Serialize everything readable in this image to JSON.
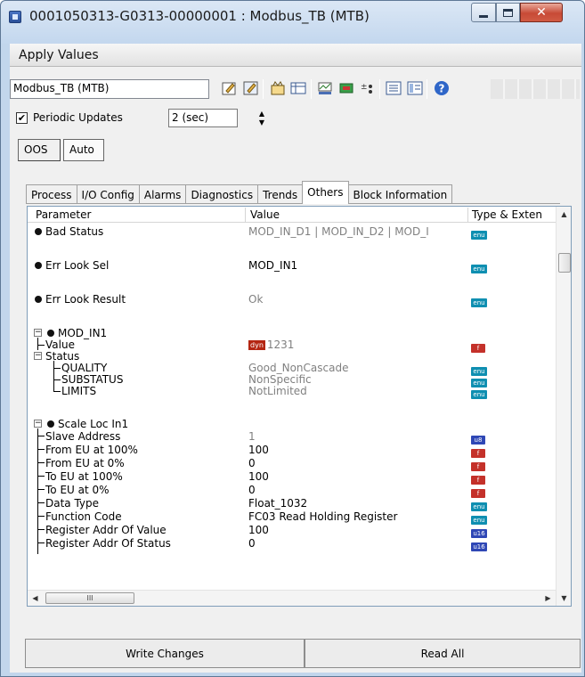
{
  "window": {
    "title": "0001050313-G0313-00000001 : Modbus_TB (MTB)",
    "icon": "app-icon"
  },
  "menu": {
    "label": "Apply Values"
  },
  "toolbar": {
    "block_select": "Modbus_TB (MTB)",
    "icons": [
      "edit-icon",
      "edit-all-icon",
      "block-info-icon",
      "spreadsheet-icon",
      "chart-icon",
      "transfer-icon",
      "tree-toggle-icon",
      "list-view-icon",
      "detail-view-icon",
      "help-icon"
    ]
  },
  "periodic": {
    "label": "Periodic Updates",
    "checked": true,
    "interval": "2 (sec)"
  },
  "modes": {
    "oos": "OOS",
    "auto": "Auto"
  },
  "tabs": [
    "Process",
    "I/O Config",
    "Alarms",
    "Diagnostics",
    "Trends",
    "Others",
    "Block Information"
  ],
  "active_tab": "Others",
  "grid": {
    "headers": {
      "parameter": "Parameter",
      "value": "Value",
      "type": "Type & Exten"
    },
    "rows": [
      {
        "name": "Bad Status",
        "value": "MOD_IN_D1 | MOD_IN_D2 | MOD_I",
        "type": "enu",
        "gray": true
      },
      {
        "name": "Err Look Sel",
        "value": "MOD_IN1",
        "type": "enu",
        "gray": false
      },
      {
        "name": "Err Look Result",
        "value": "Ok",
        "type": "enu",
        "gray": true
      },
      {
        "name": "MOD_IN1"
      },
      {
        "name": "Value",
        "value": "1231",
        "dyn": "dyn",
        "type": "f"
      },
      {
        "name": "Status"
      },
      {
        "name": "QUALITY",
        "value": "Good_NonCascade",
        "type": "enu"
      },
      {
        "name": "SUBSTATUS",
        "value": "NonSpecific",
        "type": "enu"
      },
      {
        "name": "LIMITS",
        "value": "NotLimited",
        "type": "enu"
      },
      {
        "name": "Scale Loc In1"
      },
      {
        "name": "Slave Address",
        "value": "1",
        "type": "u8"
      },
      {
        "name": "From EU at 100%",
        "value": "100",
        "type": "f"
      },
      {
        "name": "From EU at 0%",
        "value": "0",
        "type": "f"
      },
      {
        "name": "To EU at 100%",
        "value": "100",
        "type": "f"
      },
      {
        "name": "To EU at 0%",
        "value": "0",
        "type": "f"
      },
      {
        "name": "Data Type",
        "value": "Float_1032",
        "type": "enu"
      },
      {
        "name": "Function Code",
        "value": "FC03 Read Holding Register",
        "type": "enu"
      },
      {
        "name": "Register Addr Of Value",
        "value": "100",
        "type": "u16"
      },
      {
        "name": "Register Addr Of Status",
        "value": "0",
        "type": "u16"
      }
    ],
    "hscroll_grip": "III"
  },
  "buttons": {
    "write": "Write Changes",
    "read": "Read All"
  },
  "colors": {
    "enum_tag": "#0f8fb1",
    "float_tag": "#c4312a",
    "uint_tag": "#2f47b5",
    "dyn_tag": "#b42612"
  }
}
